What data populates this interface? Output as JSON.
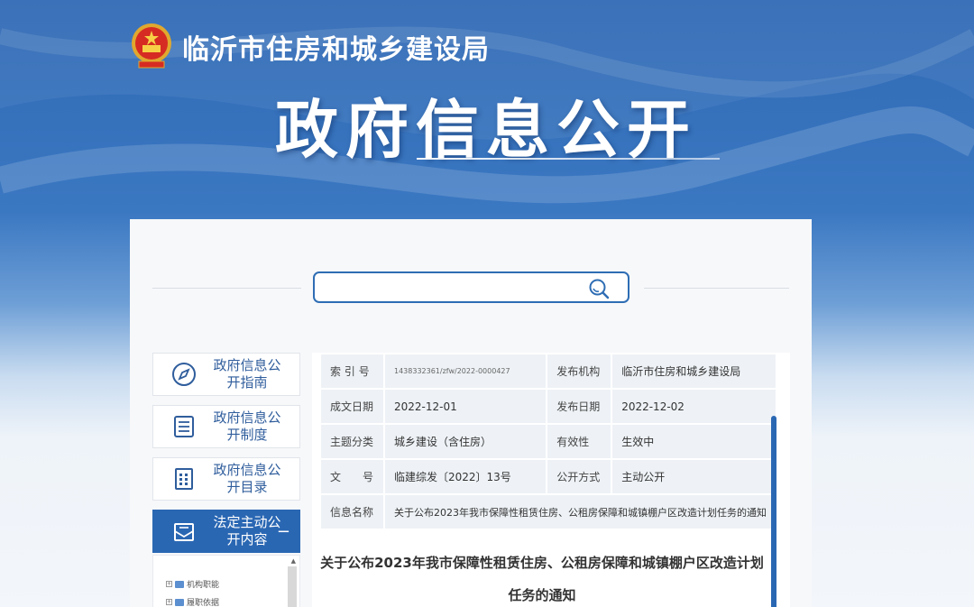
{
  "header": {
    "agency_name": "临沂市住房和城乡建设局",
    "big_title": "政府信息公开"
  },
  "search": {
    "placeholder": "",
    "icon": "search-icon"
  },
  "side_nav": [
    {
      "label": "政府信息公开指南",
      "icon": "compass-icon",
      "active": false
    },
    {
      "label": "政府信息公开制度",
      "icon": "document-list-icon",
      "active": false
    },
    {
      "label": "政府信息公开目录",
      "icon": "catalog-grid-icon",
      "active": false
    },
    {
      "label": "法定主动公开内容",
      "icon": "envelope-icon",
      "active": true,
      "toggle": "−"
    }
  ],
  "tree": {
    "items": [
      "机构职能",
      "履职依据"
    ]
  },
  "meta": {
    "index_no_label": "索 引 号",
    "index_no_value": "1438332361/zfw/2022-0000427",
    "publisher_label": "发布机构",
    "publisher_value": "临沂市住房和城乡建设局",
    "created_label": "成文日期",
    "created_value": "2022-12-01",
    "published_label": "发布日期",
    "published_value": "2022-12-02",
    "topic_label": "主题分类",
    "topic_value": "城乡建设（含住房）",
    "validity_label": "有效性",
    "validity_value": "生效中",
    "docno_label": "文　　号",
    "docno_value": "临建综发〔2022〕13号",
    "disclosure_label": "公开方式",
    "disclosure_value": "主动公开",
    "name_label": "信息名称",
    "name_value": "关于公布2023年我市保障性租赁住房、公租房保障和城镇棚户区改造计划任务的通知"
  },
  "document": {
    "title_line1": "关于公布2023年我市保障性租赁住房、公租房保障和城镇棚户区改造计划",
    "title_line2": "任务的通知"
  },
  "colors": {
    "brand_blue": "#2a67b3",
    "banner_top": "#2f69b4",
    "nav_text": "#2f5d9c"
  }
}
